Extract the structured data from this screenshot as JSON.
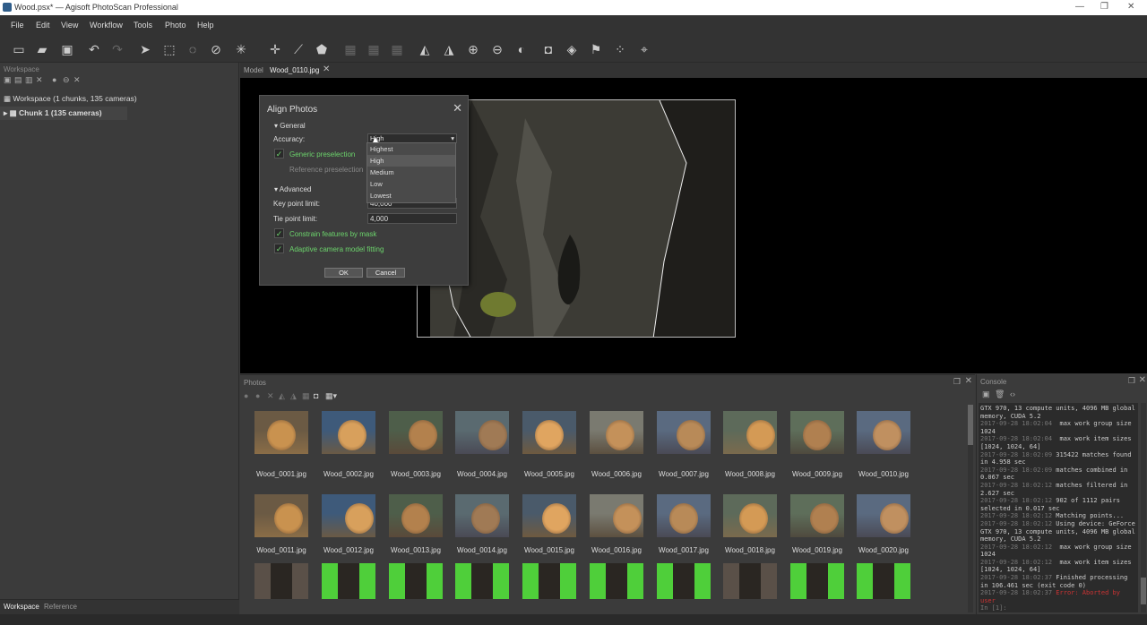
{
  "window": {
    "title": "Wood.psx* — Agisoft PhotoScan Professional",
    "min": "—",
    "max": "❐",
    "close": "✕"
  },
  "menu": [
    "File",
    "Edit",
    "View",
    "Workflow",
    "Tools",
    "Photo",
    "Help"
  ],
  "workspace": {
    "header": "Workspace",
    "root": "Workspace (1 chunks, 135 cameras)",
    "chunk": "Chunk 1 (135 cameras)",
    "tabs": [
      "Workspace",
      "Reference"
    ]
  },
  "viewer": {
    "tabs": [
      "Model",
      "Wood_0110.jpg"
    ]
  },
  "dialog": {
    "title": "Align Photos",
    "general_label": "General",
    "accuracy_label": "Accuracy:",
    "accuracy_value": "High",
    "accuracy_options": [
      "Highest",
      "High",
      "Medium",
      "Low",
      "Lowest"
    ],
    "generic_preselection": "Generic preselection",
    "reference_preselection": "Reference preselection",
    "advanced_label": "Advanced",
    "key_point_label": "Key point limit:",
    "key_point_value": "40,000",
    "tie_point_label": "Tie point limit:",
    "tie_point_value": "4,000",
    "constrain_mask": "Constrain features by mask",
    "adaptive_fitting": "Adaptive camera model fitting",
    "ok": "OK",
    "cancel": "Cancel"
  },
  "photos": {
    "header": "Photos",
    "items": [
      "Wood_0001.jpg",
      "Wood_0002.jpg",
      "Wood_0003.jpg",
      "Wood_0004.jpg",
      "Wood_0005.jpg",
      "Wood_0006.jpg",
      "Wood_0007.jpg",
      "Wood_0008.jpg",
      "Wood_0009.jpg",
      "Wood_0010.jpg",
      "Wood_0011.jpg",
      "Wood_0012.jpg",
      "Wood_0013.jpg",
      "Wood_0014.jpg",
      "Wood_0015.jpg",
      "Wood_0016.jpg",
      "Wood_0017.jpg",
      "Wood_0018.jpg",
      "Wood_0019.jpg",
      "Wood_0020.jpg"
    ]
  },
  "console": {
    "header": "Console",
    "lines": [
      {
        "ts": "",
        "msg": "GTX 970, 13 compute units, 4096 MB global memory, CUDA 5.2"
      },
      {
        "ts": "2017-09-28 18:02:04",
        "msg": "  max work group size 1024"
      },
      {
        "ts": "2017-09-28 18:02:04",
        "msg": "  max work item sizes [1024, 1024, 64]"
      },
      {
        "ts": "2017-09-28 18:02:09",
        "msg": " 315422 matches found in 4.958 sec"
      },
      {
        "ts": "2017-09-28 18:02:09",
        "msg": " matches combined in 0.067 sec"
      },
      {
        "ts": "2017-09-28 18:02:12",
        "msg": " matches filtered in 2.627 sec"
      },
      {
        "ts": "2017-09-28 18:02:12",
        "msg": " 902 of 1112 pairs selected in 0.017 sec"
      },
      {
        "ts": "2017-09-28 18:02:12",
        "msg": " Matching points..."
      },
      {
        "ts": "2017-09-28 18:02:12",
        "msg": " Using device: GeForce GTX 970, 13 compute units, 4096 MB global memory, CUDA 5.2"
      },
      {
        "ts": "2017-09-28 18:02:12",
        "msg": "  max work group size 1024"
      },
      {
        "ts": "2017-09-28 18:02:12",
        "msg": "  max work item sizes [1024, 1024, 64]"
      },
      {
        "ts": "2017-09-28 18:02:37",
        "msg": " Finished processing in 106.461 sec (exit code 0)"
      },
      {
        "ts": "2017-09-28 18:02:37",
        "msg": " ",
        "error": "Error: Aborted by user"
      },
      {
        "ts": "",
        "msg": ""
      },
      {
        "ts": "In [1]:",
        "msg": ""
      }
    ]
  },
  "colors": {
    "accent_green": "#6cd46c",
    "background": "#3a3a3a",
    "viewer": "#000000"
  }
}
